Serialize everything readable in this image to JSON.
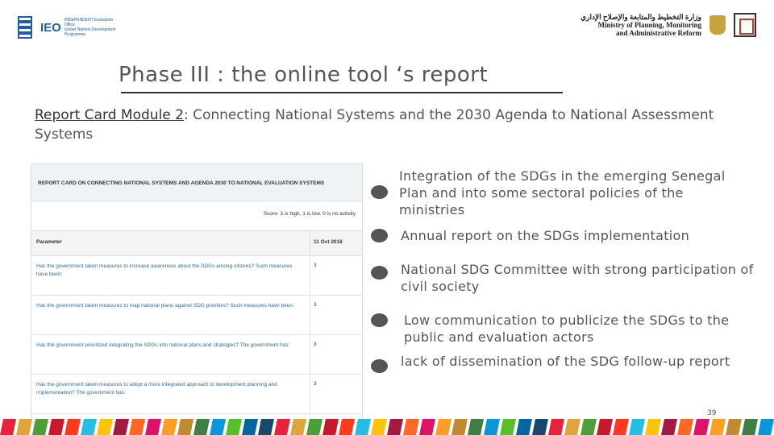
{
  "header": {
    "ieo_text": "IEO",
    "ieo_subtext": "INDEPENDENT Evaluation Office",
    "ieo_tagline": "United Nations Development Programme",
    "ministry_arabic": "وزارة التخطيط والمتابعة والإصلاح الإداري",
    "ministry_line1": "Ministry of Planning, Monitoring",
    "ministry_line2": "and Administrative Reform"
  },
  "title": "Phase III : the online tool ‘s report",
  "subtitle": {
    "module": "Report Card Module 2",
    "text": ": Connecting National Systems and the 2030 Agenda to National Assessment Systems"
  },
  "card": {
    "heading": "REPORT CARD ON CONNECTING NATIONAL SYSTEMS AND AGENDA 2030 TO NATIONAL EVALUATION SYSTEMS",
    "score_note": "Score: 3 is high, 1 is low. 0 is no activity",
    "col_parameter": "Parameter",
    "col_date": "11 Oct 2018",
    "rows": [
      {
        "text": "Has the government taken measures to increase awareness about the SDGs among citizens? Such measures have been:",
        "score": "3"
      },
      {
        "text": "Has the government taken measures to map national plans against SDG priorities? Such measures have been:",
        "score": "3"
      },
      {
        "text": "Has the government prioritized integrating the SDGs into national plans and strategies? The government has:",
        "score": "3"
      },
      {
        "text": "Has the government taken measures to adopt a more integrated approach to development planning and implementation? The government has:",
        "score": "3"
      }
    ]
  },
  "bullets": [
    {
      "text": "Integration of the SDGs in the emerging Senegal Plan and into some sectoral policies of the ministries"
    },
    {
      "text": "Annual report on the SDGs implementation"
    },
    {
      "text": "National SDG Committee with strong participation of civil society"
    },
    {
      "text": "Low communication to publicize the SDGs to the public and evaluation actors"
    },
    {
      "text": "lack of dissemination of the SDG follow-up report"
    }
  ],
  "page_number": "39",
  "sdg_colors": [
    "#e5243b",
    "#dda63a",
    "#4c9f38",
    "#c5192d",
    "#ff3a21",
    "#26bde2",
    "#fcc30b",
    "#a21942",
    "#fd6925",
    "#dd1367",
    "#fd9d24",
    "#bf8b2e",
    "#3f7e44",
    "#0a97d9",
    "#56c02b",
    "#00689d",
    "#19486a"
  ]
}
